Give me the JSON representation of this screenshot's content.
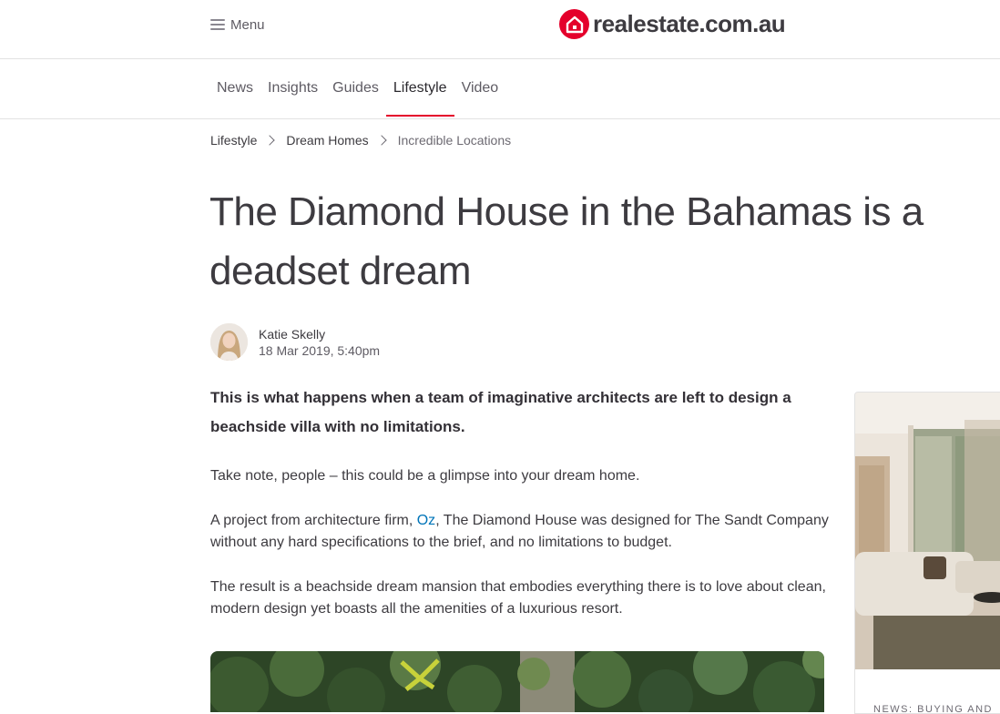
{
  "header": {
    "menu_label": "Menu",
    "logo_text": "realestate.com.au"
  },
  "nav": {
    "tabs": [
      {
        "label": "News",
        "active": false
      },
      {
        "label": "Insights",
        "active": false
      },
      {
        "label": "Guides",
        "active": false
      },
      {
        "label": "Lifestyle",
        "active": true
      },
      {
        "label": "Video",
        "active": false
      }
    ]
  },
  "breadcrumb": [
    "Lifestyle",
    "Dream Homes",
    "Incredible Locations"
  ],
  "article": {
    "title": "The Diamond House in the Bahamas is a deadset dream",
    "author": "Katie Skelly",
    "date": "18 Mar 2019, 5:40pm",
    "lede": "This is what happens when a team of imaginative architects are left to design a beachside villa with no limitations.",
    "p1": "Take note, people – this could be a glimpse into your dream home.",
    "p2_before": "A project from architecture firm, ",
    "p2_link": "Oz",
    "p2_after": ", The Diamond House was designed for The Sandt Company without any hard specifications to the brief, and no limitations to budget.",
    "p3": "The result is a beachside dream mansion that embodies everything there is to love about clean, modern design yet boasts all the amenities of a luxurious resort."
  },
  "sidebar": {
    "category": "NEWS: BUYING AND"
  },
  "colors": {
    "brand_red": "#e4002b",
    "link_blue": "#0074b8",
    "text": "#3d3b40"
  }
}
